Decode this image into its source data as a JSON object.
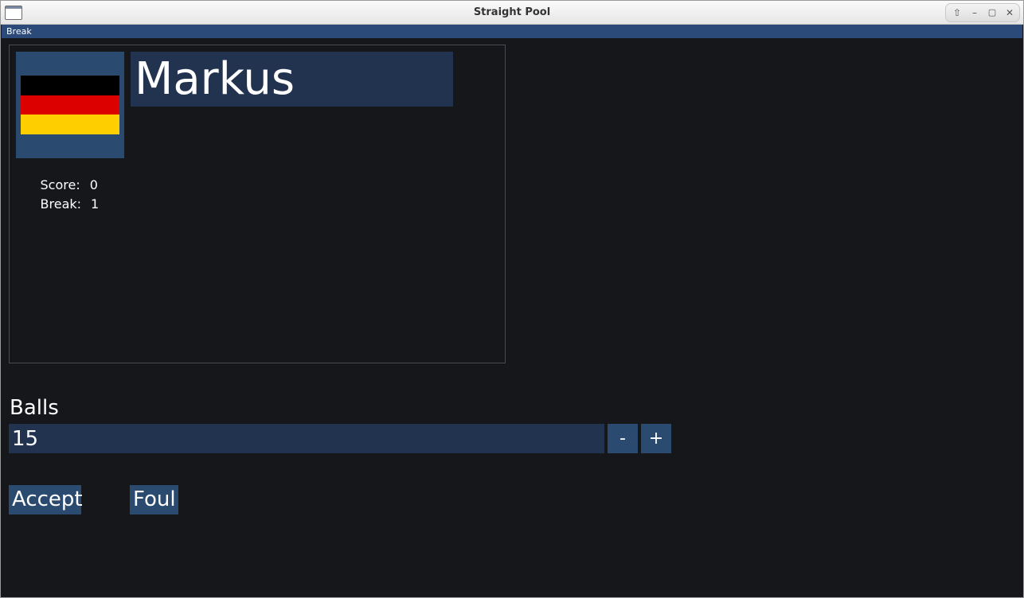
{
  "window": {
    "title": "Straight Pool"
  },
  "menubar": {
    "items": [
      {
        "label": "Break"
      }
    ]
  },
  "player": {
    "name": "Markus",
    "flag_country": "Germany",
    "flag_colors": [
      "#000000",
      "#dd0000",
      "#ffce00"
    ],
    "score_label": "Score:",
    "score_value": "0",
    "break_label": "Break:",
    "break_value": "1"
  },
  "balls": {
    "label": "Balls",
    "value": "15",
    "decrement_label": "-",
    "increment_label": "+"
  },
  "actions": {
    "accept_label": "Accept",
    "foul_label": "Foul"
  },
  "colors": {
    "background": "#16171b",
    "panel_accent": "#2a4a70",
    "field_background": "#223350",
    "menubar": "#2b4a79"
  }
}
